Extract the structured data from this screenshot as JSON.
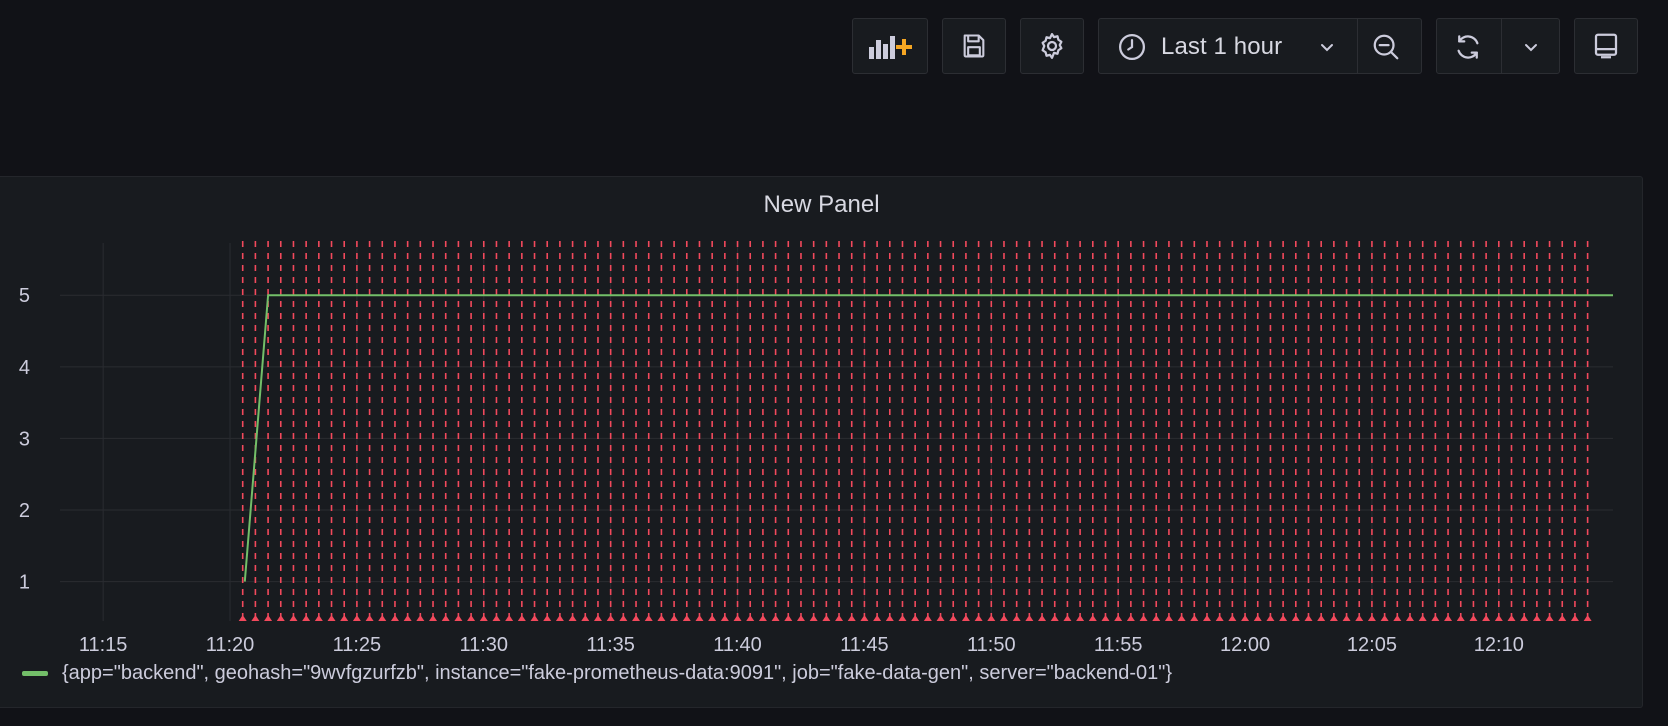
{
  "toolbar": {
    "add_panel_icon": "add-panel-icon",
    "save_icon": "save-icon",
    "settings_icon": "gear-icon",
    "time_range_label": "Last 1 hour",
    "refresh_icon": "refresh-icon",
    "tv_mode_icon": "monitor-icon"
  },
  "panel": {
    "title": "New Panel",
    "legend_label": "{app=\"backend\", geohash=\"9wvfgzurfzb\", instance=\"fake-prometheus-data:9091\", job=\"fake-data-gen\", server=\"backend-01\"}"
  },
  "colors": {
    "background": "#111217",
    "panel_bg": "#181b1f",
    "series": "#73bf69",
    "annotation": "#f2495c",
    "accent_plus": "#f5a623"
  },
  "chart_data": {
    "type": "line",
    "x_tick_labels": [
      "11:15",
      "11:20",
      "11:25",
      "11:30",
      "11:35",
      "11:40",
      "11:45",
      "11:50",
      "11:55",
      "12:00",
      "12:05",
      "12:10"
    ],
    "y_tick_labels": [
      "1",
      "2",
      "3",
      "4",
      "5"
    ],
    "ylim": [
      0.45,
      5.45
    ],
    "xlim": [
      "11:13:18",
      "12:14:30"
    ],
    "grid": true,
    "legend_position": "bottom-left",
    "series": [
      {
        "color": "#73bf69",
        "points": [
          {
            "x": "11:20:35",
            "y": 1
          },
          {
            "x": "11:21:30",
            "y": 5
          },
          {
            "x": "12:14:30",
            "y": 5
          }
        ]
      }
    ],
    "annotations": {
      "color": "#f2495c",
      "style": "dashed-vertical",
      "start": "11:20:30",
      "end": "12:13:45",
      "interval_seconds": 30
    }
  }
}
